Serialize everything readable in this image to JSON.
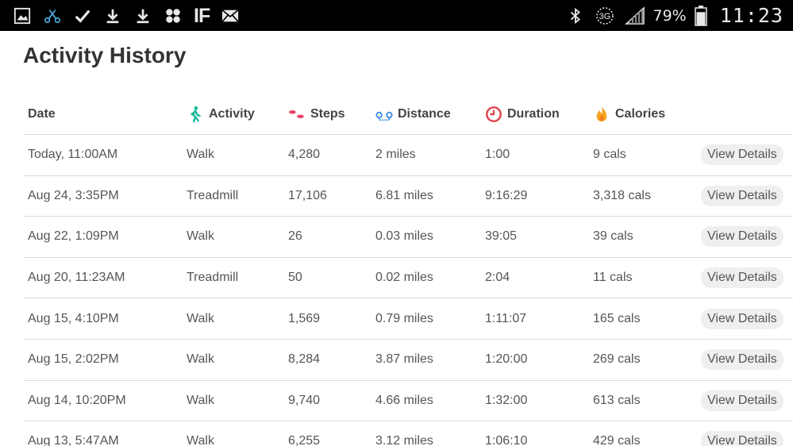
{
  "statusbar": {
    "left_icons": [
      "gallery-icon",
      "scissors-icon",
      "check-icon",
      "download-icon",
      "download-icon",
      "pinwheel-icon",
      "ifttt-icon",
      "mail-icon"
    ],
    "ifttt_text": "IF",
    "network_label": "3G",
    "battery_percent": "79%",
    "battery_level": 0.79,
    "time": "11:23"
  },
  "page": {
    "title": "Activity History"
  },
  "table": {
    "headers": {
      "date": "Date",
      "activity": "Activity",
      "steps": "Steps",
      "distance": "Distance",
      "duration": "Duration",
      "calories": "Calories"
    },
    "header_icons": {
      "activity": "walker-icon",
      "steps": "footprints-icon",
      "distance": "distance-icon",
      "duration": "clock-icon",
      "calories": "flame-icon"
    },
    "colors": {
      "walker": "#1abc9c",
      "footprints": "#e8436a",
      "distance": "#3c8de0",
      "clock": "#e0404a",
      "flame": "#f5a623"
    },
    "rows": [
      {
        "date": "Today, 11:00AM",
        "activity": "Walk",
        "steps": "4,280",
        "distance": "2 miles",
        "duration": "1:00",
        "calories": "9 cals",
        "button": "View Details"
      },
      {
        "date": "Aug 24, 3:35PM",
        "activity": "Treadmill",
        "steps": "17,106",
        "distance": "6.81 miles",
        "duration": "9:16:29",
        "calories": "3,318 cals",
        "button": "View Details"
      },
      {
        "date": "Aug 22, 1:09PM",
        "activity": "Walk",
        "steps": "26",
        "distance": "0.03 miles",
        "duration": "39:05",
        "calories": "39 cals",
        "button": "View Details"
      },
      {
        "date": "Aug 20, 11:23AM",
        "activity": "Treadmill",
        "steps": "50",
        "distance": "0.02 miles",
        "duration": "2:04",
        "calories": "11 cals",
        "button": "View Details"
      },
      {
        "date": "Aug 15, 4:10PM",
        "activity": "Walk",
        "steps": "1,569",
        "distance": "0.79 miles",
        "duration": "1:11:07",
        "calories": "165 cals",
        "button": "View Details"
      },
      {
        "date": "Aug 15, 2:02PM",
        "activity": "Walk",
        "steps": "8,284",
        "distance": "3.87 miles",
        "duration": "1:20:00",
        "calories": "269 cals",
        "button": "View Details"
      },
      {
        "date": "Aug 14, 10:20PM",
        "activity": "Walk",
        "steps": "9,740",
        "distance": "4.66 miles",
        "duration": "1:32:00",
        "calories": "613 cals",
        "button": "View Details"
      },
      {
        "date": "Aug 13, 5:47AM",
        "activity": "Walk",
        "steps": "6,255",
        "distance": "3.12 miles",
        "duration": "1:06:10",
        "calories": "429 cals",
        "button": "View Details"
      }
    ]
  }
}
